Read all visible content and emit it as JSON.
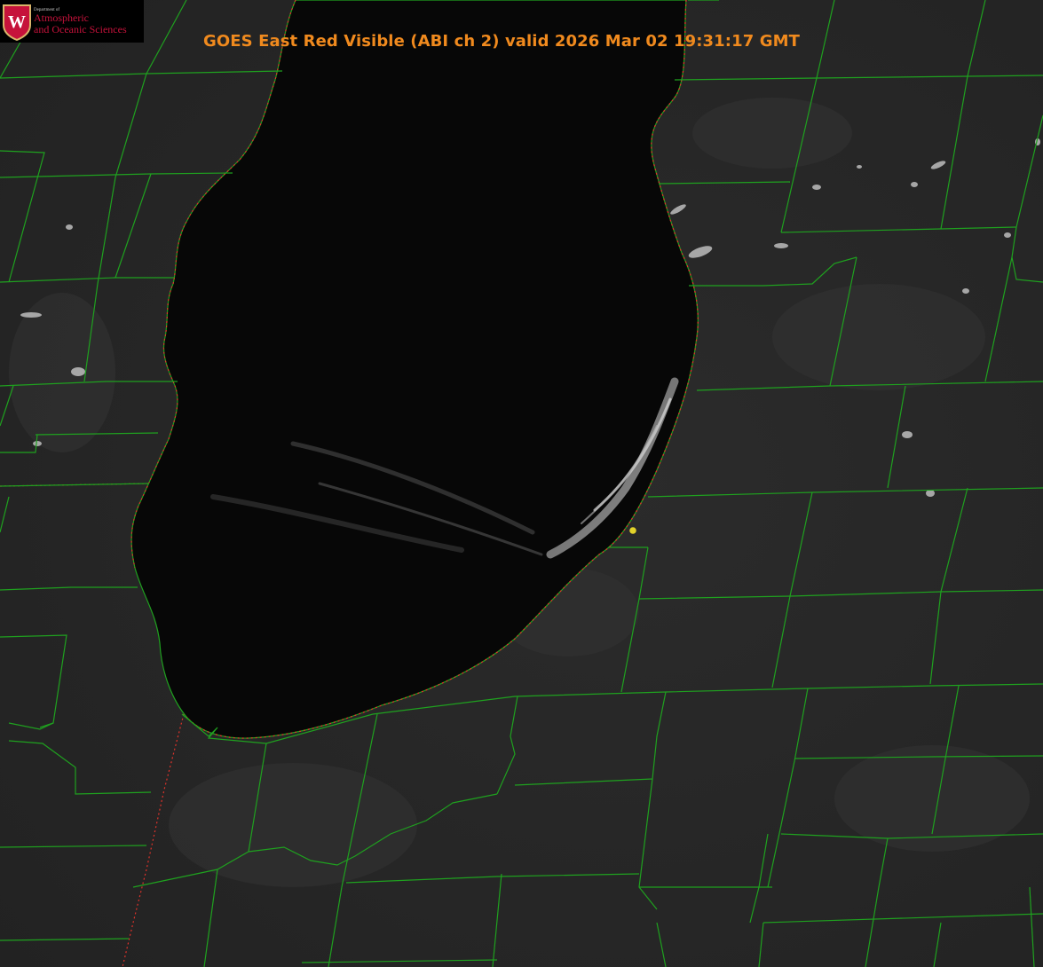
{
  "title": "GOES East Red Visible (ABI ch 2) valid 2026 Mar 02 19:31:17 GMT",
  "logo": {
    "dept": "Department of",
    "line1": "Atmospheric",
    "line2": "and Oceanic Sciences",
    "crest_letter": "W"
  },
  "colors": {
    "title": "#f08a1e",
    "county_lines": "#1fa11f",
    "state_line": "#e0322a",
    "marker": "#e2d22a",
    "lake": "#070707",
    "land": "#272727",
    "logo_red": "#c6123b"
  }
}
